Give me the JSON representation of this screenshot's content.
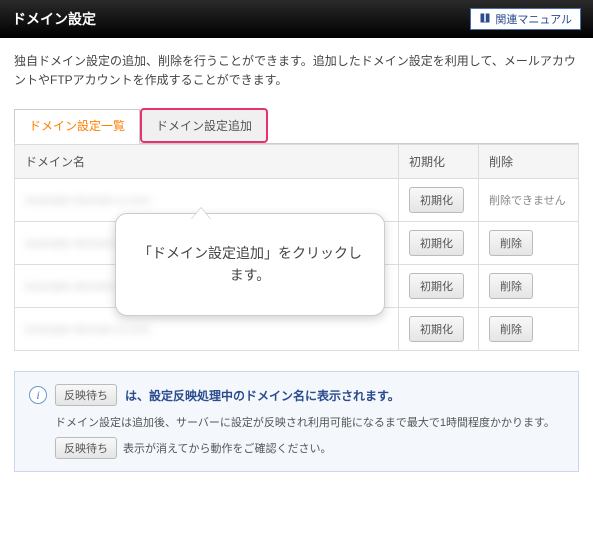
{
  "header": {
    "title": "ドメイン設定",
    "manual_label": "関連マニュアル"
  },
  "description": "独自ドメイン設定の追加、削除を行うことができます。追加したドメイン設定を利用して、メールアカウントやFTPアカウントを作成することができます。",
  "tabs": {
    "list": "ドメイン設定一覧",
    "add": "ドメイン設定追加"
  },
  "table": {
    "col_domain": "ドメイン名",
    "col_init": "初期化",
    "col_delete": "削除",
    "init_btn": "初期化",
    "delete_btn": "削除",
    "delete_disabled": "削除できません",
    "rows": [
      {
        "placeholder": "example-domain-a.com"
      },
      {
        "placeholder": "example-domain-b.com"
      },
      {
        "placeholder": "example-domain-c.com"
      },
      {
        "placeholder": "example-domain-d.com"
      }
    ]
  },
  "callout": "「ドメイン設定追加」をクリックします。",
  "info": {
    "badge": "反映待ち",
    "line1_suffix": "は、設定反映処理中のドメイン名に表示されます。",
    "line2": "ドメイン設定は追加後、サーバーに設定が反映され利用可能になるまで最大で1時間程度かかります。",
    "line3_suffix": "表示が消えてから動作をご確認ください。"
  }
}
